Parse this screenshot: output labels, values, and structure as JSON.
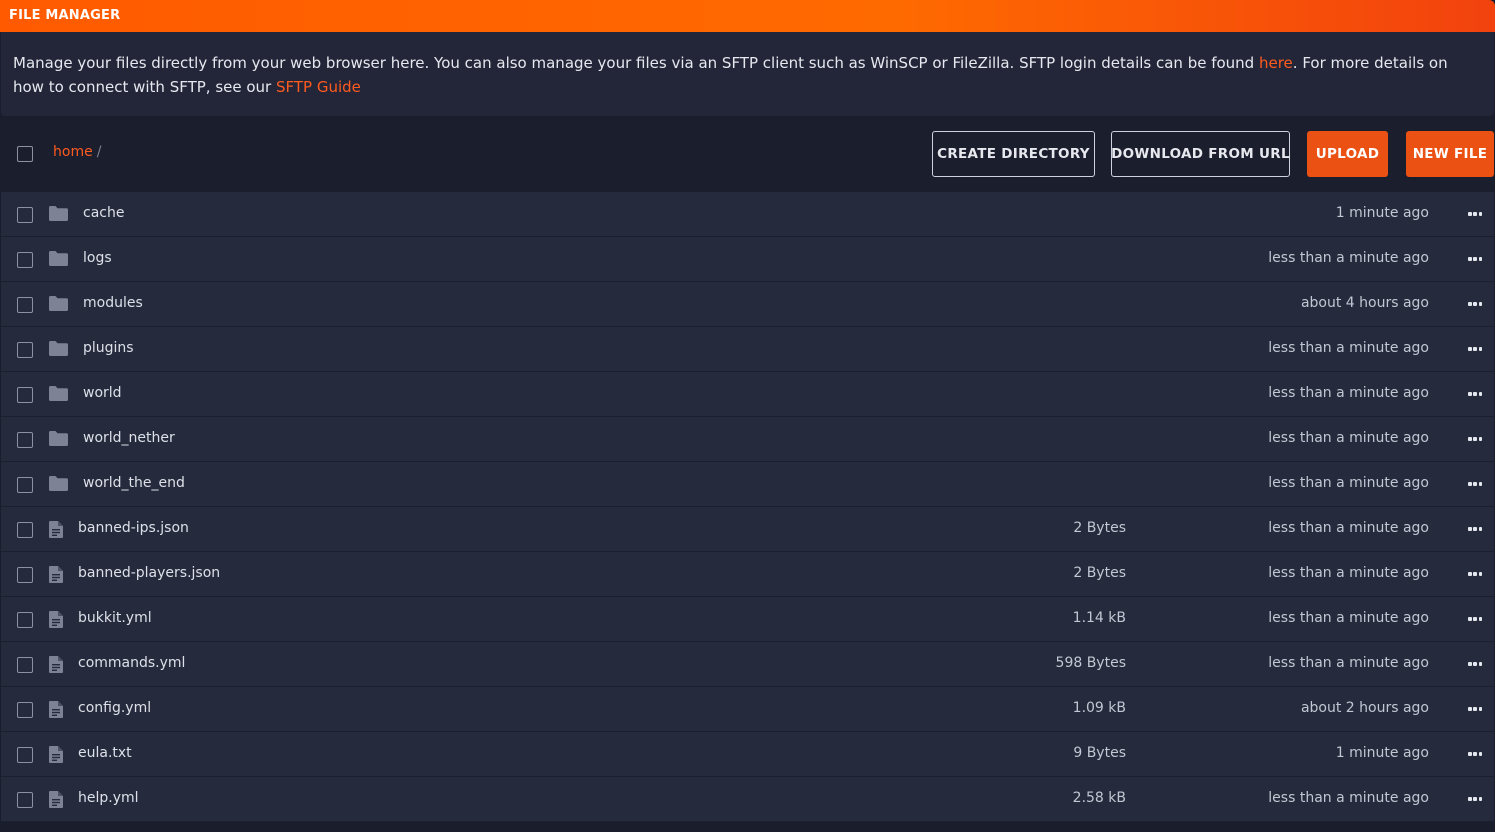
{
  "header": {
    "title": "FILE MANAGER"
  },
  "info": {
    "text_before": "Manage your files directly from your web browser here. You can also manage your files via an SFTP client such as WinSCP or FileZilla. SFTP login details can be found ",
    "link1": "here",
    "text_middle": ". For more details on how to connect with SFTP, see our ",
    "link2": "SFTP Guide"
  },
  "breadcrumb": {
    "home": "home",
    "separator": "/"
  },
  "toolbar": {
    "create_directory": "CREATE DIRECTORY",
    "download_from_url": "DOWNLOAD FROM URL",
    "upload": "UPLOAD",
    "new_file": "NEW FILE"
  },
  "colors": {
    "accent": "#ea5113",
    "link": "#ff5a1f",
    "row_bg": "#252a3c",
    "page_bg": "#1a1d2b"
  },
  "files": [
    {
      "type": "folder",
      "icon": "folder-icon",
      "name": "cache",
      "size": "",
      "modified": "1 minute ago"
    },
    {
      "type": "folder",
      "icon": "folder-icon",
      "name": "logs",
      "size": "",
      "modified": "less than a minute ago"
    },
    {
      "type": "folder",
      "icon": "folder-icon",
      "name": "modules",
      "size": "",
      "modified": "about 4 hours ago"
    },
    {
      "type": "folder",
      "icon": "folder-icon",
      "name": "plugins",
      "size": "",
      "modified": "less than a minute ago"
    },
    {
      "type": "folder",
      "icon": "folder-icon",
      "name": "world",
      "size": "",
      "modified": "less than a minute ago"
    },
    {
      "type": "folder",
      "icon": "folder-icon",
      "name": "world_nether",
      "size": "",
      "modified": "less than a minute ago"
    },
    {
      "type": "folder",
      "icon": "folder-icon",
      "name": "world_the_end",
      "size": "",
      "modified": "less than a minute ago"
    },
    {
      "type": "file",
      "icon": "file-icon",
      "name": "banned-ips.json",
      "size": "2 Bytes",
      "modified": "less than a minute ago"
    },
    {
      "type": "file",
      "icon": "file-icon",
      "name": "banned-players.json",
      "size": "2 Bytes",
      "modified": "less than a minute ago"
    },
    {
      "type": "file",
      "icon": "file-icon",
      "name": "bukkit.yml",
      "size": "1.14 kB",
      "modified": "less than a minute ago"
    },
    {
      "type": "file",
      "icon": "file-icon",
      "name": "commands.yml",
      "size": "598 Bytes",
      "modified": "less than a minute ago"
    },
    {
      "type": "file",
      "icon": "file-icon",
      "name": "config.yml",
      "size": "1.09 kB",
      "modified": "about 2 hours ago"
    },
    {
      "type": "file",
      "icon": "file-icon",
      "name": "eula.txt",
      "size": "9 Bytes",
      "modified": "1 minute ago"
    },
    {
      "type": "file",
      "icon": "file-icon",
      "name": "help.yml",
      "size": "2.58 kB",
      "modified": "less than a minute ago"
    }
  ]
}
